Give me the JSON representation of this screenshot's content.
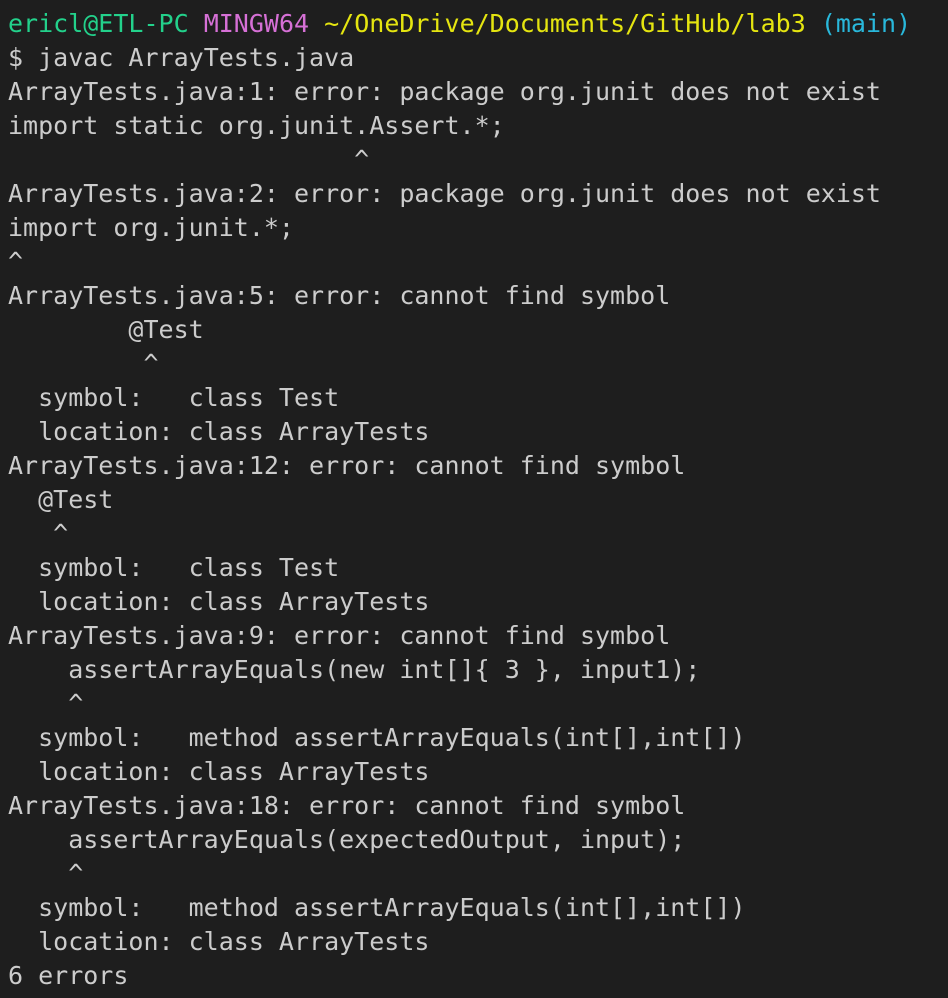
{
  "prompt": {
    "user_host": "ericl@ETL-PC",
    "system": "MINGW64",
    "path": "~/OneDrive/Documents/GitHub/lab3",
    "branch": "(main)",
    "symbol": "$",
    "command": "javac ArrayTests.java"
  },
  "colors": {
    "background": "#1e1e1e",
    "foreground": "#cccccc",
    "user_host": "#23d18b",
    "system": "#d670d6",
    "path": "#e5e510",
    "branch": "#29b8db"
  },
  "output": [
    "ArrayTests.java:1: error: package org.junit does not exist",
    "import static org.junit.Assert.*;",
    "                       ^",
    "ArrayTests.java:2: error: package org.junit does not exist",
    "import org.junit.*;",
    "^",
    "ArrayTests.java:5: error: cannot find symbol",
    "        @Test",
    "         ^",
    "  symbol:   class Test",
    "  location: class ArrayTests",
    "ArrayTests.java:12: error: cannot find symbol",
    "  @Test",
    "   ^",
    "  symbol:   class Test",
    "  location: class ArrayTests",
    "ArrayTests.java:9: error: cannot find symbol",
    "    assertArrayEquals(new int[]{ 3 }, input1);",
    "    ^",
    "  symbol:   method assertArrayEquals(int[],int[])",
    "  location: class ArrayTests",
    "ArrayTests.java:18: error: cannot find symbol",
    "    assertArrayEquals(expectedOutput, input);",
    "    ^",
    "  symbol:   method assertArrayEquals(int[],int[])",
    "  location: class ArrayTests",
    "6 errors"
  ]
}
